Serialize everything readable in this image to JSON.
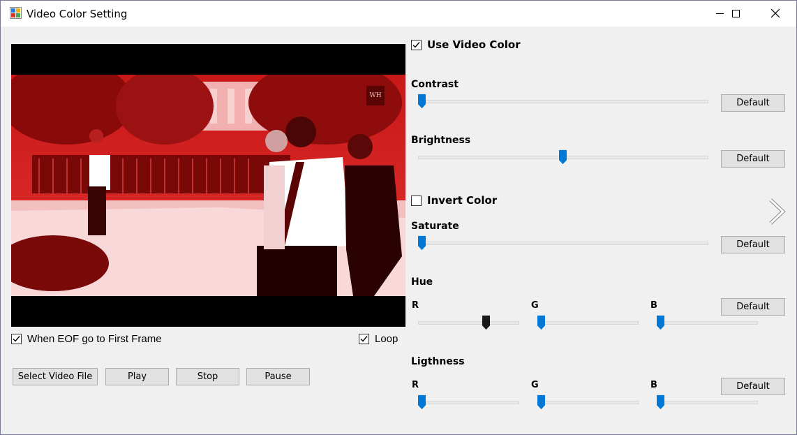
{
  "window": {
    "title": "Video Color Setting",
    "controls": [
      "minimize-icon",
      "maximize-icon",
      "close-icon"
    ]
  },
  "player": {
    "eof_label": "When EOF go to First Frame",
    "eof_checked": true,
    "loop_label": "Loop",
    "loop_checked": true,
    "buttons": {
      "select": "Select Video File",
      "play": "Play",
      "stop": "Stop",
      "pause": "Pause"
    }
  },
  "settings": {
    "use_video_color_label": "Use Video Color",
    "use_video_color_checked": true,
    "contrast": {
      "label": "Contrast",
      "value": 0.0,
      "default_label": "Default"
    },
    "brightness": {
      "label": "Brightness",
      "value": 0.5,
      "default_label": "Default"
    },
    "invert_label": "Invert Color",
    "invert_checked": false,
    "saturate": {
      "label": "Saturate",
      "value": 0.0,
      "default_label": "Default"
    },
    "hue": {
      "label": "Hue",
      "r_label": "R",
      "g_label": "G",
      "b_label": "B",
      "r_value": 0.7,
      "g_value": 0.0,
      "b_value": 0.0,
      "default_label": "Default"
    },
    "lightness": {
      "label": "Ligthness",
      "r_label": "R",
      "g_label": "G",
      "b_label": "B",
      "r_value": 0.0,
      "g_value": 0.0,
      "b_value": 0.0,
      "default_label": "Default"
    }
  },
  "colors": {
    "accent": "#0078d7",
    "active_thumb": "#1a1a1a",
    "tint": "#d01010"
  }
}
